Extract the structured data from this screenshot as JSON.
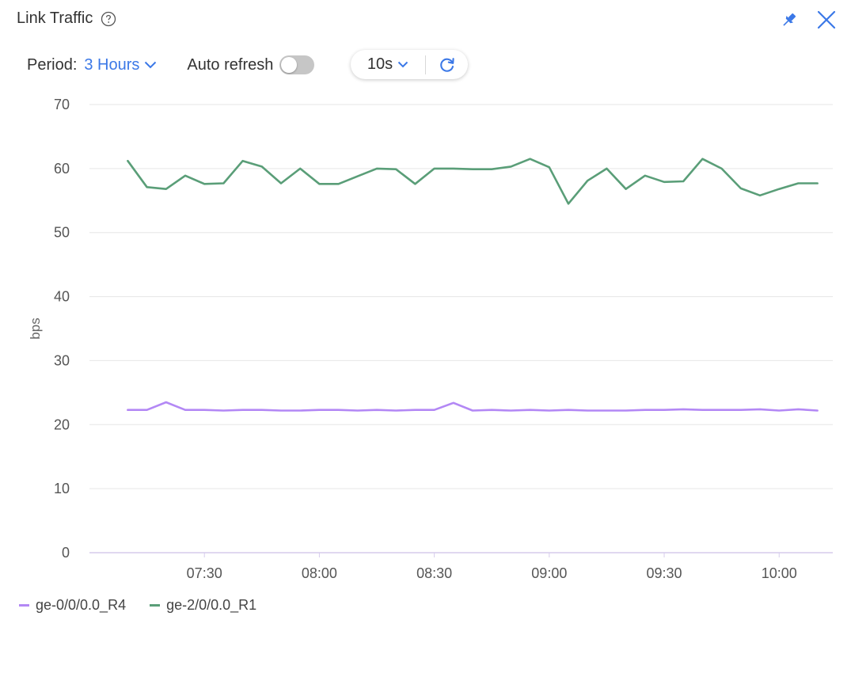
{
  "panel": {
    "title": "Link Traffic",
    "help_icon": "help-circle-icon",
    "pin_icon": "pin-icon",
    "close_icon": "close-icon"
  },
  "toolbar": {
    "period_label": "Period:",
    "period_value": "3 Hours",
    "auto_refresh_label": "Auto refresh",
    "auto_refresh_on": false,
    "interval_value": "10s",
    "refresh_icon": "refresh-icon"
  },
  "colors": {
    "accent": "#3b78e7",
    "series_r4": "#b388f5",
    "series_r1": "#5a9e78",
    "grid": "#e6e6e6",
    "axis": "#d6ccec"
  },
  "chart_data": {
    "type": "line",
    "ylabel": "bps",
    "xlabel": "",
    "ylim": [
      0,
      70
    ],
    "yticks": [
      0,
      10,
      20,
      30,
      40,
      50,
      60,
      70
    ],
    "x_ticks": [
      "07:30",
      "08:00",
      "08:30",
      "09:00",
      "09:30",
      "10:00"
    ],
    "x": [
      "07:10",
      "07:15",
      "07:20",
      "07:25",
      "07:30",
      "07:35",
      "07:40",
      "07:45",
      "07:50",
      "07:55",
      "08:00",
      "08:05",
      "08:10",
      "08:15",
      "08:20",
      "08:25",
      "08:30",
      "08:35",
      "08:40",
      "08:45",
      "08:50",
      "08:55",
      "09:00",
      "09:05",
      "09:10",
      "09:15",
      "09:20",
      "09:25",
      "09:30",
      "09:35",
      "09:40",
      "09:45",
      "09:50",
      "09:55",
      "10:00",
      "10:05",
      "10:10"
    ],
    "series": [
      {
        "name": "ge-0/0/0.0_R4",
        "values": [
          22.3,
          22.3,
          23.5,
          22.3,
          22.3,
          22.2,
          22.3,
          22.3,
          22.2,
          22.2,
          22.3,
          22.3,
          22.2,
          22.3,
          22.2,
          22.3,
          22.3,
          23.4,
          22.2,
          22.3,
          22.2,
          22.3,
          22.2,
          22.3,
          22.2,
          22.2,
          22.2,
          22.3,
          22.3,
          22.4,
          22.3,
          22.3,
          22.3,
          22.4,
          22.2,
          22.4,
          22.2
        ]
      },
      {
        "name": "ge-2/0/0.0_R1",
        "values": [
          61.2,
          57.1,
          56.8,
          58.9,
          57.6,
          57.7,
          61.2,
          60.3,
          57.7,
          60.0,
          57.6,
          57.6,
          58.8,
          60.0,
          59.9,
          57.6,
          60.0,
          60.0,
          59.9,
          59.9,
          60.3,
          61.5,
          60.2,
          54.5,
          58.1,
          60.0,
          56.8,
          58.9,
          57.9,
          58.0,
          61.5,
          60.0,
          56.9,
          55.8,
          56.8,
          57.7,
          57.7
        ]
      }
    ]
  }
}
